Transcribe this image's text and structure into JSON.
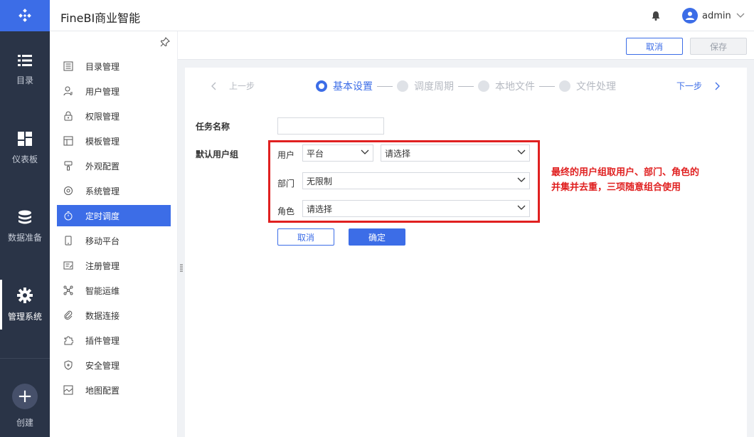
{
  "rail": {
    "items": [
      {
        "label": "目录",
        "icon": "list-icon"
      },
      {
        "label": "仪表板",
        "icon": "dashboard-icon"
      },
      {
        "label": "数据准备",
        "icon": "database-icon"
      },
      {
        "label": "管理系统",
        "icon": "gear-icon",
        "active": true
      },
      {
        "label": "创建",
        "icon": "plus-icon"
      }
    ]
  },
  "header": {
    "title": "FineBI商业智能",
    "user_name": "admin"
  },
  "sidebar": {
    "items": [
      {
        "label": "目录管理",
        "icon": "catalog-icon"
      },
      {
        "label": "用户管理",
        "icon": "user-icon"
      },
      {
        "label": "权限管理",
        "icon": "lock-icon"
      },
      {
        "label": "模板管理",
        "icon": "template-icon"
      },
      {
        "label": "外观配置",
        "icon": "brush-icon"
      },
      {
        "label": "系统管理",
        "icon": "settings-icon"
      },
      {
        "label": "定时调度",
        "icon": "timer-icon",
        "active": true
      },
      {
        "label": "移动平台",
        "icon": "mobile-icon"
      },
      {
        "label": "注册管理",
        "icon": "register-icon"
      },
      {
        "label": "智能运维",
        "icon": "ops-icon"
      },
      {
        "label": "数据连接",
        "icon": "link-icon"
      },
      {
        "label": "插件管理",
        "icon": "plugin-icon"
      },
      {
        "label": "安全管理",
        "icon": "shield-icon"
      },
      {
        "label": "地图配置",
        "icon": "map-icon"
      }
    ]
  },
  "actions": {
    "cancel": "取消",
    "save": "保存"
  },
  "wizard": {
    "prev": "上一步",
    "next": "下一步",
    "steps": [
      "基本设置",
      "调度周期",
      "本地文件",
      "文件处理"
    ],
    "current_step": 0
  },
  "form": {
    "task_name_label": "任务名称",
    "task_name_value": "",
    "default_group_label": "默认用户组",
    "user_label": "用户",
    "user_type_value": "平台",
    "user_value": "请选择",
    "department_label": "部门",
    "department_value": "无限制",
    "role_label": "角色",
    "role_value": "请选择",
    "cancel": "取消",
    "confirm": "确定"
  },
  "annotation": {
    "line1": "最终的用户组取用户、部门、角色的",
    "line2": "并集并去重，三项随意组合使用"
  },
  "colors": {
    "accent": "#3c6de7",
    "rail": "#2a3447",
    "annotation": "#e02020"
  }
}
